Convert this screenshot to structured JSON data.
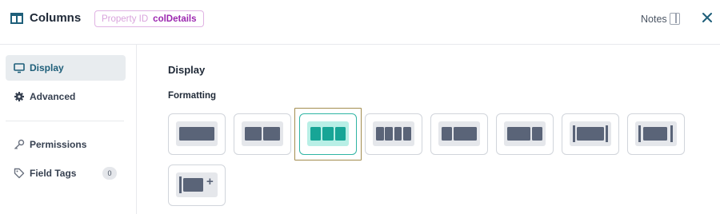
{
  "header": {
    "title": "Columns",
    "property_label": "Property ID",
    "property_value": "colDetails",
    "notes_label": "Notes"
  },
  "sidebar": {
    "items": [
      {
        "label": "Display",
        "icon": "monitor-icon",
        "active": true
      },
      {
        "label": "Advanced",
        "icon": "gear-icon",
        "active": false
      },
      {
        "label": "Permissions",
        "icon": "key-icon",
        "active": false
      },
      {
        "label": "Field Tags",
        "icon": "tag-icon",
        "active": false,
        "count": "0"
      }
    ]
  },
  "main": {
    "section_title": "Display",
    "formatting_label": "Formatting",
    "selected_option": 2
  },
  "colors": {
    "accent": "#17a596",
    "selected_frame": "#a38d4f",
    "badge_purple": "#9c27b0"
  }
}
